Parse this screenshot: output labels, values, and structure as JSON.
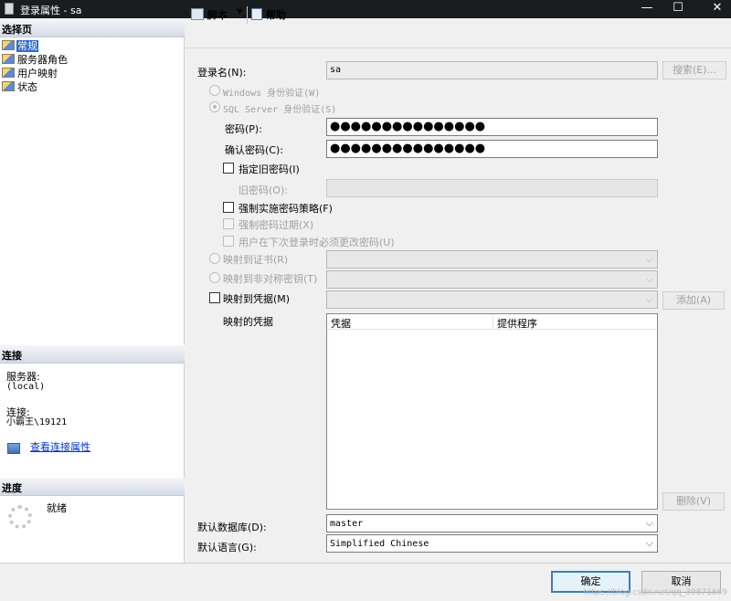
{
  "window": {
    "title": "登录属性 - sa",
    "minimize": "—",
    "maximize": "☐",
    "close": "✕"
  },
  "left": {
    "select_page_header": "选择页",
    "pages": [
      "常规",
      "服务器角色",
      "用户映射",
      "状态"
    ],
    "connection_header": "连接",
    "server_label": "服务器:",
    "server_value": "(local)",
    "connection_label": "连接:",
    "connection_value": "小霸王\\19121",
    "view_connection_link": "查看连接属性",
    "progress_header": "进度",
    "progress_status": "就绪"
  },
  "toolbar": {
    "script_label": "脚本",
    "dropdown_arrow": "▼",
    "help_label": "帮助"
  },
  "form": {
    "login_name_label": "登录名(N):",
    "login_name_value": "sa",
    "search_button": "搜索(E)...",
    "windows_auth": "Windows 身份验证(W)",
    "sql_auth": "SQL Server 身份验证(S)",
    "password_label": "密码(P):",
    "password_value": "●●●●●●●●●●●●●●●",
    "confirm_password_label": "确认密码(C):",
    "confirm_password_value": "●●●●●●●●●●●●●●●",
    "specify_old_password": "指定旧密码(I)",
    "old_password_label": "旧密码(O):",
    "enforce_policy": "强制实施密码策略(F)",
    "enforce_expiration": "强制密码过期(X)",
    "must_change": "用户在下次登录时必须更改密码(U)",
    "map_certificate": "映射到证书(R)",
    "map_asymmetric_key": "映射到非对称密钥(T)",
    "map_credential": "映射到凭据(M)",
    "add_button": "添加(A)",
    "mapped_credentials_label": "映射的凭据",
    "cred_col_credential": "凭据",
    "cred_col_provider": "提供程序",
    "remove_button": "删除(V)",
    "default_db_label": "默认数据库(D):",
    "default_db_value": "master",
    "default_lang_label": "默认语言(G):",
    "default_lang_value": "Simplified Chinese",
    "combo_arrow": "⌵"
  },
  "footer": {
    "ok_button": "确定",
    "cancel_button": "取消",
    "watermark": "https://blog.csdn.net/qq_39871869"
  }
}
